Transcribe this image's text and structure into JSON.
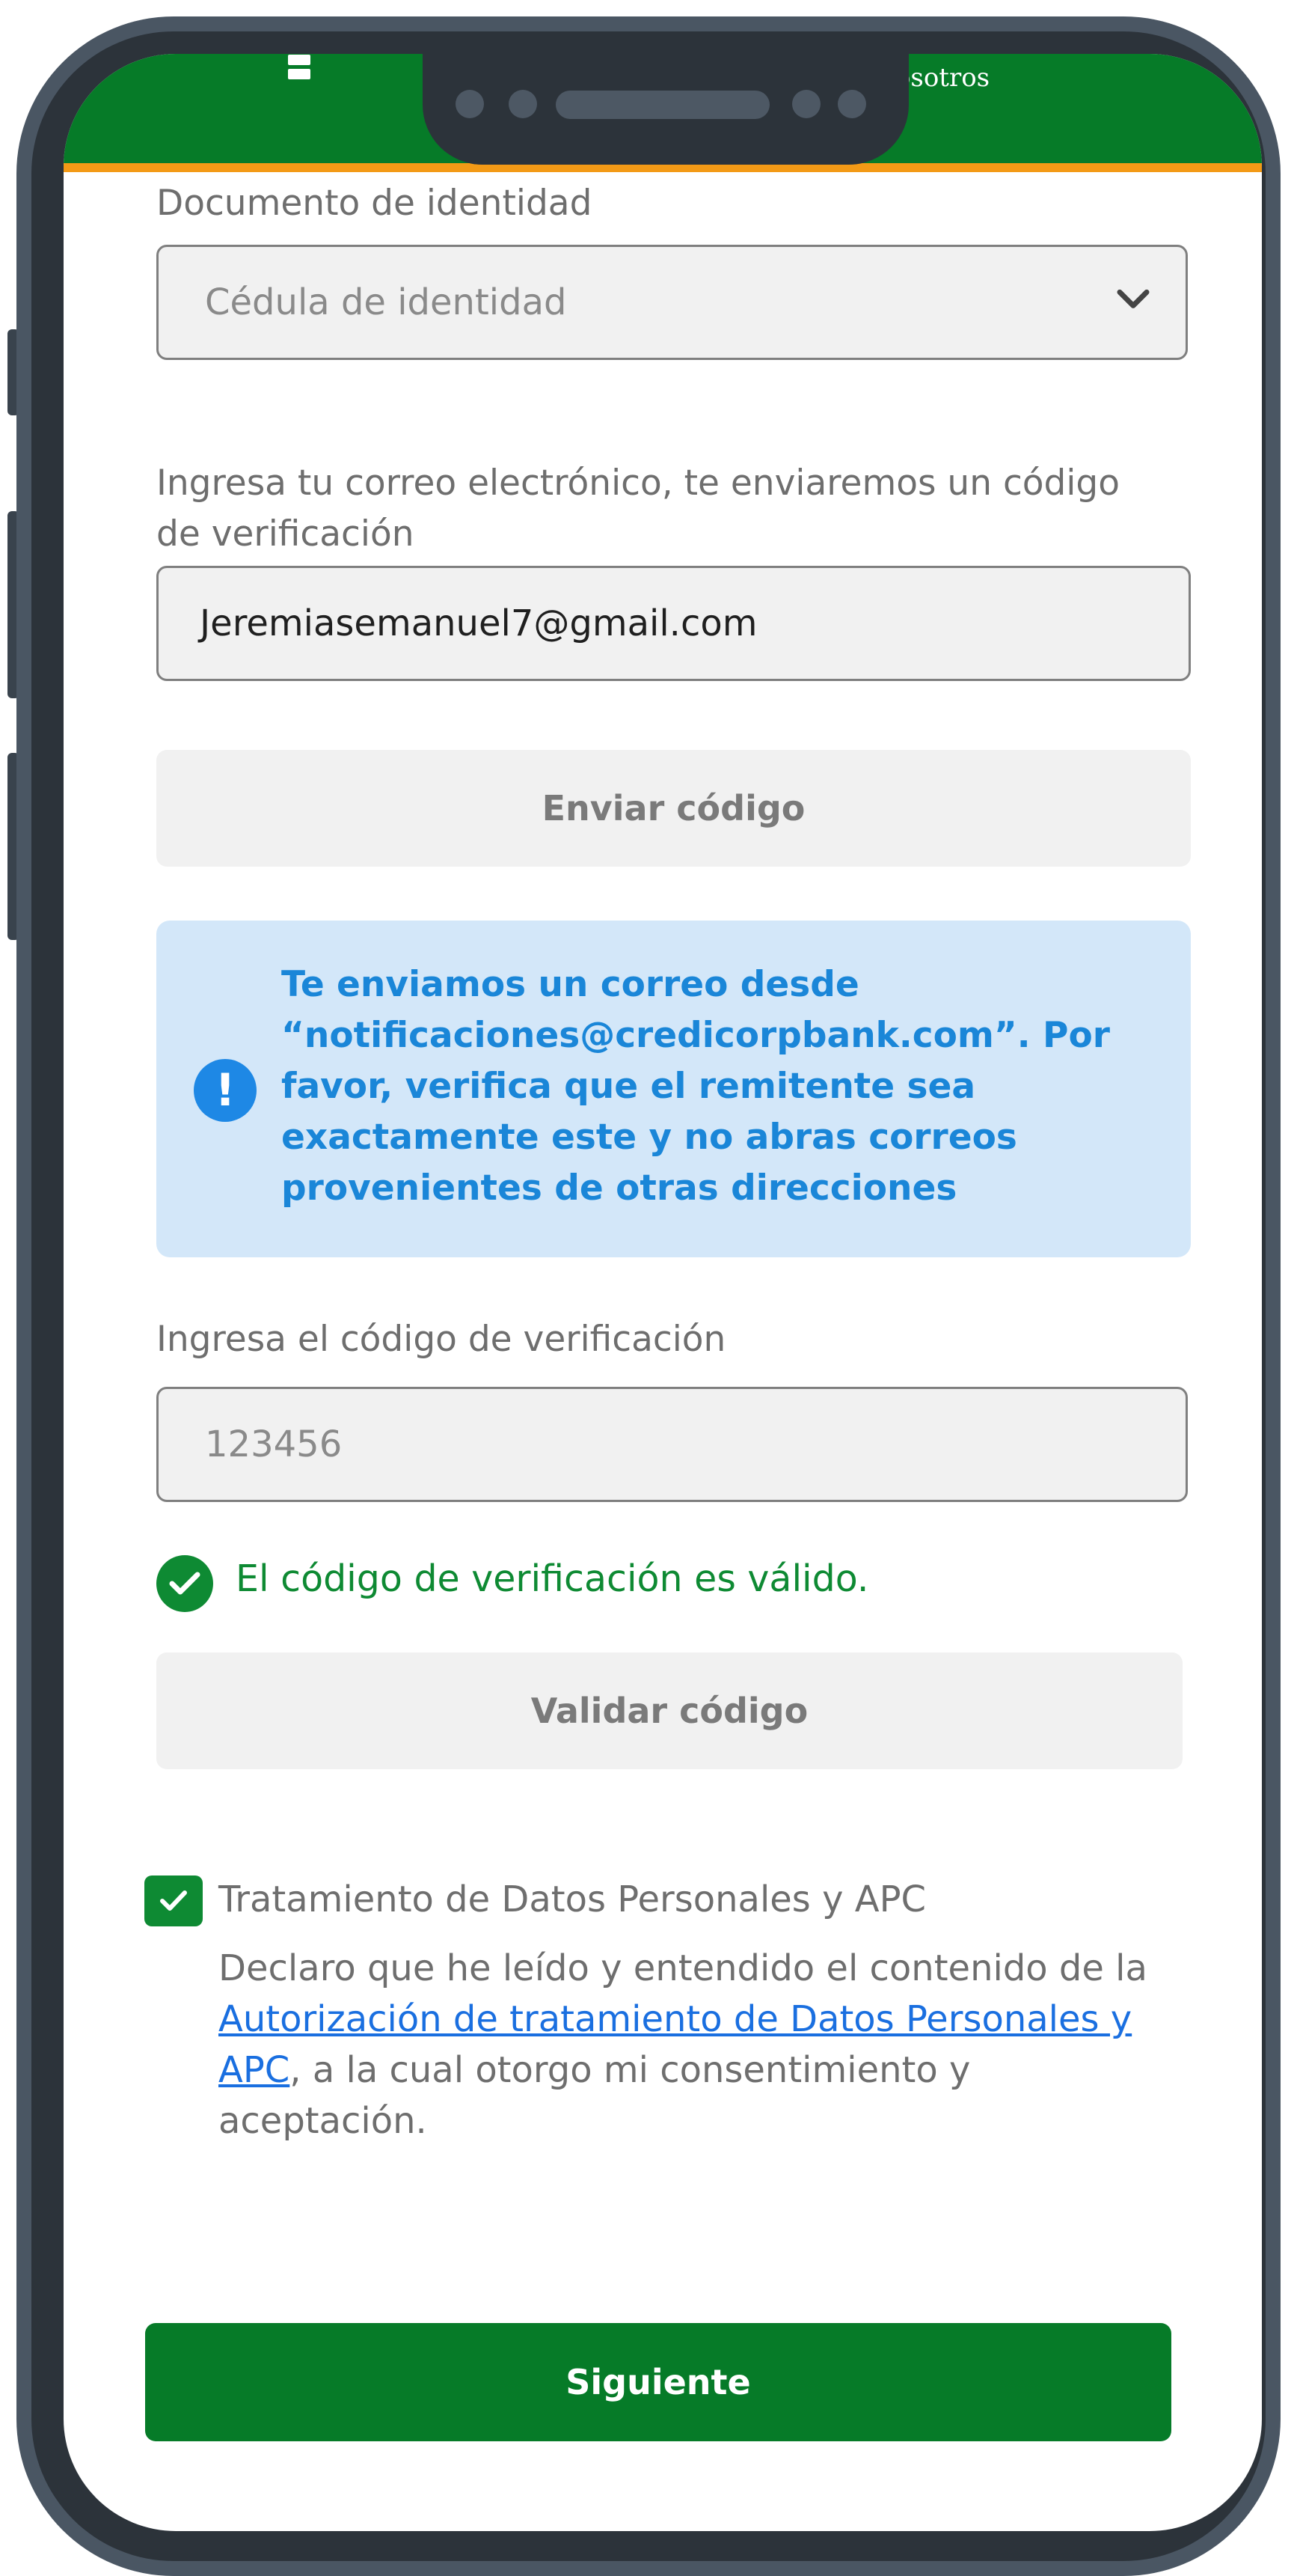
{
  "header": {
    "link_label": "nosotros"
  },
  "form": {
    "document_label": "Documento de identidad",
    "document_value": "Cédula de identidad",
    "email_label": "Ingresa tu correo electrónico, te enviaremos un código de verificación",
    "email_value": "Jeremiasemanuel7@gmail.com",
    "send_code_label": "Enviar código",
    "info_message": "Te enviamos un correo desde “notificaciones@credicorpbank.com”. Por favor, verifica que el remitente sea exactamente este y no abras correos provenientes de otras direcciones",
    "info_icon_glyph": "!",
    "code_label": "Ingresa el código de verificación",
    "code_value": "123456",
    "valid_message": "El código de verificación es válido.",
    "validate_code_label": "Validar código",
    "terms_title": "Tratamiento de Datos Personales y APC",
    "terms_text_before": "Declaro que he leído y entendido el contenido de la ",
    "terms_link": "Autorización de tratamiento de Datos Personales y APC",
    "terms_text_after": ", a la cual otorgo mi consentimiento y aceptación.",
    "terms_checked": true,
    "next_label": "Siguiente"
  },
  "icons": {
    "document_dropdown": "chevron-down-icon",
    "info": "exclamation-icon",
    "valid": "check-circle-icon",
    "terms": "checkbox-checked-icon"
  },
  "colors": {
    "brand_green": "#067b28",
    "accent_orange": "#f39a16",
    "info_blue": "#1a86d8",
    "info_bg": "#d3e7f9",
    "success_green": "#0e8a33"
  }
}
